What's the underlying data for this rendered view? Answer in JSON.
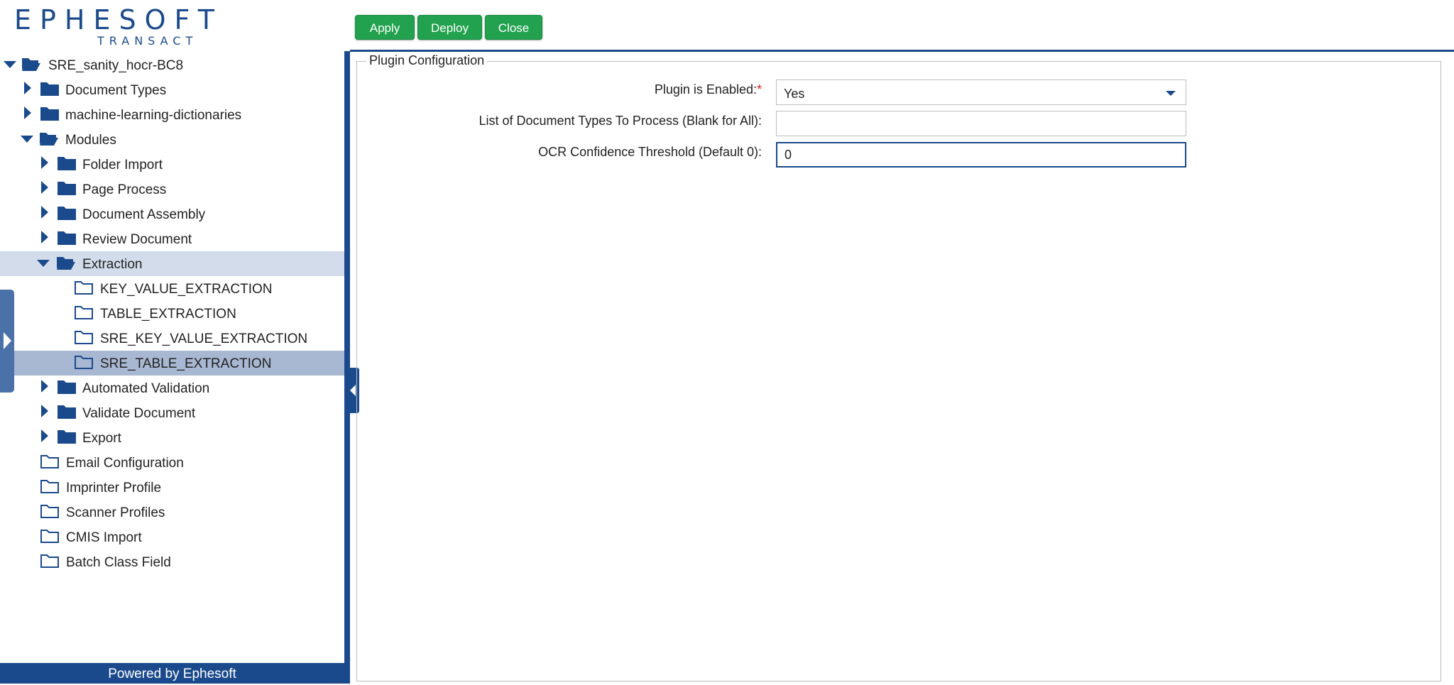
{
  "app": {
    "logo_word": "EPHESOFT",
    "logo_sub": "TRANSACT",
    "footer": "Powered by Ephesoft"
  },
  "colors": {
    "brand_blue": "#1b4a8c",
    "button_green": "#22a24f",
    "selected_row": "#a8b8d2",
    "highlight_row": "#d2dcea",
    "required": "#d9231b"
  },
  "toolbar": {
    "apply_label": "Apply",
    "deploy_label": "Deploy",
    "close_label": "Close"
  },
  "tree": {
    "root": "SRE_sanity_hocr-BC8",
    "document_types": "Document Types",
    "ml_dictionaries": "machine-learning-dictionaries",
    "modules": "Modules",
    "folder_import": "Folder Import",
    "page_process": "Page Process",
    "document_assembly": "Document Assembly",
    "review_document": "Review Document",
    "extraction": "Extraction",
    "key_value_extraction": "KEY_VALUE_EXTRACTION",
    "table_extraction": "TABLE_EXTRACTION",
    "sre_key_value_extraction": "SRE_KEY_VALUE_EXTRACTION",
    "sre_table_extraction": "SRE_TABLE_EXTRACTION",
    "automated_validation": "Automated Validation",
    "validate_document": "Validate Document",
    "export": "Export",
    "email_configuration": "Email Configuration",
    "imprinter_profile": "Imprinter Profile",
    "scanner_profiles": "Scanner Profiles",
    "cmis_import": "CMIS Import",
    "batch_class_field": "Batch Class Field"
  },
  "plugin_config": {
    "legend": "Plugin Configuration",
    "enabled_label": "Plugin is Enabled:",
    "required_mark": "*",
    "enabled_value": "Yes",
    "doc_types_label": "List of Document Types To Process (Blank for All):",
    "doc_types_value": "",
    "ocr_label": "OCR Confidence Threshold (Default 0):",
    "ocr_value": "0"
  }
}
